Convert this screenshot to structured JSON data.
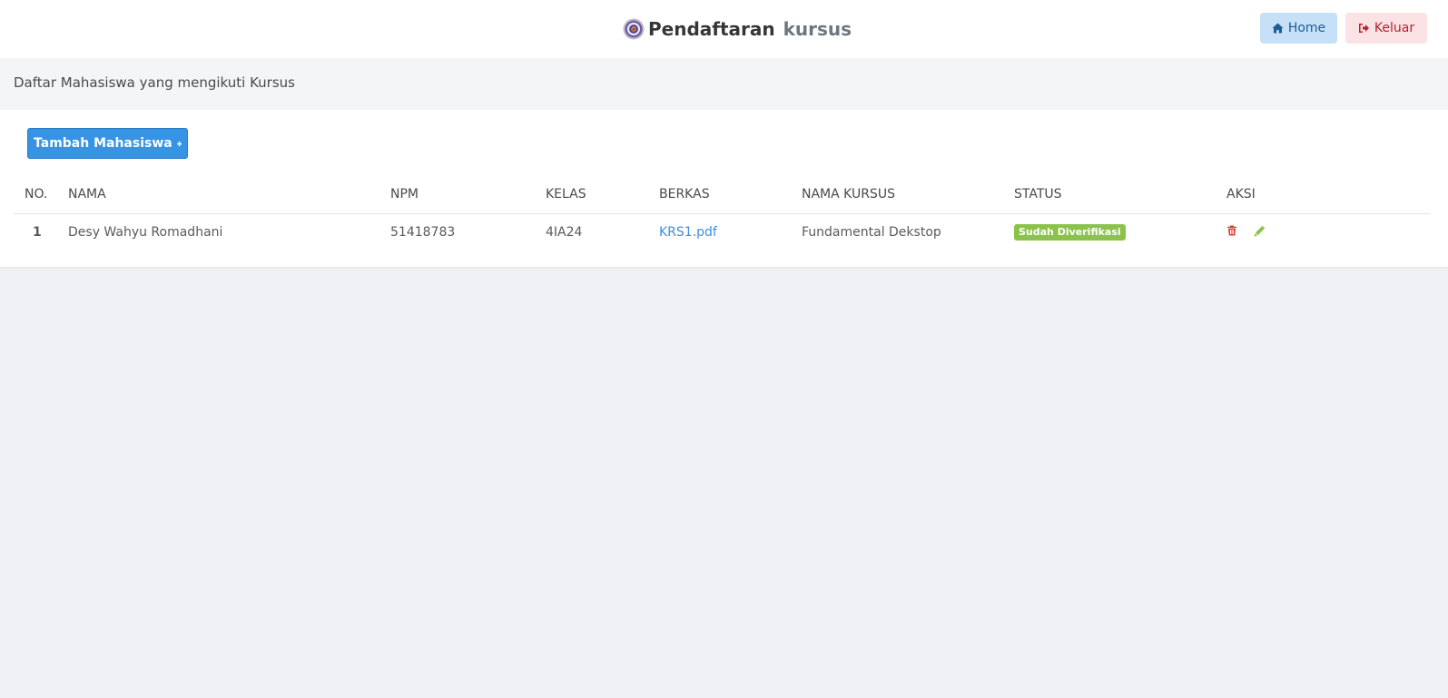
{
  "header": {
    "title_main": "Pendaftaran",
    "title_sub": "kursus",
    "logo_icon": "university-seal-icon",
    "home_label": "Home",
    "home_icon": "home-icon",
    "logout_label": "Keluar",
    "logout_icon": "sign-out-icon"
  },
  "page": {
    "heading": "Daftar Mahasiswa yang mengikuti Kursus",
    "add_button_label": "Tambah Mahasiswa",
    "add_button_icon": "plus-icon"
  },
  "table": {
    "columns": [
      "NO.",
      "NAMA",
      "NPM",
      "KELAS",
      "BERKAS",
      "NAMA KURSUS",
      "STATUS",
      "AKSI"
    ],
    "rows": [
      {
        "no": "1",
        "nama": "Desy Wahyu Romadhani",
        "npm": "51418783",
        "kelas": "4IA24",
        "berkas": "KRS1.pdf",
        "nama_kursus": "Fundamental Dekstop",
        "status": "Sudah Diverifikasi",
        "actions": [
          "trash-icon",
          "pencil-icon"
        ]
      }
    ]
  },
  "colors": {
    "primary": "#3794e4",
    "status_verified": "#8bc34a",
    "delete": "#e53935",
    "edit": "#8bc34a"
  }
}
